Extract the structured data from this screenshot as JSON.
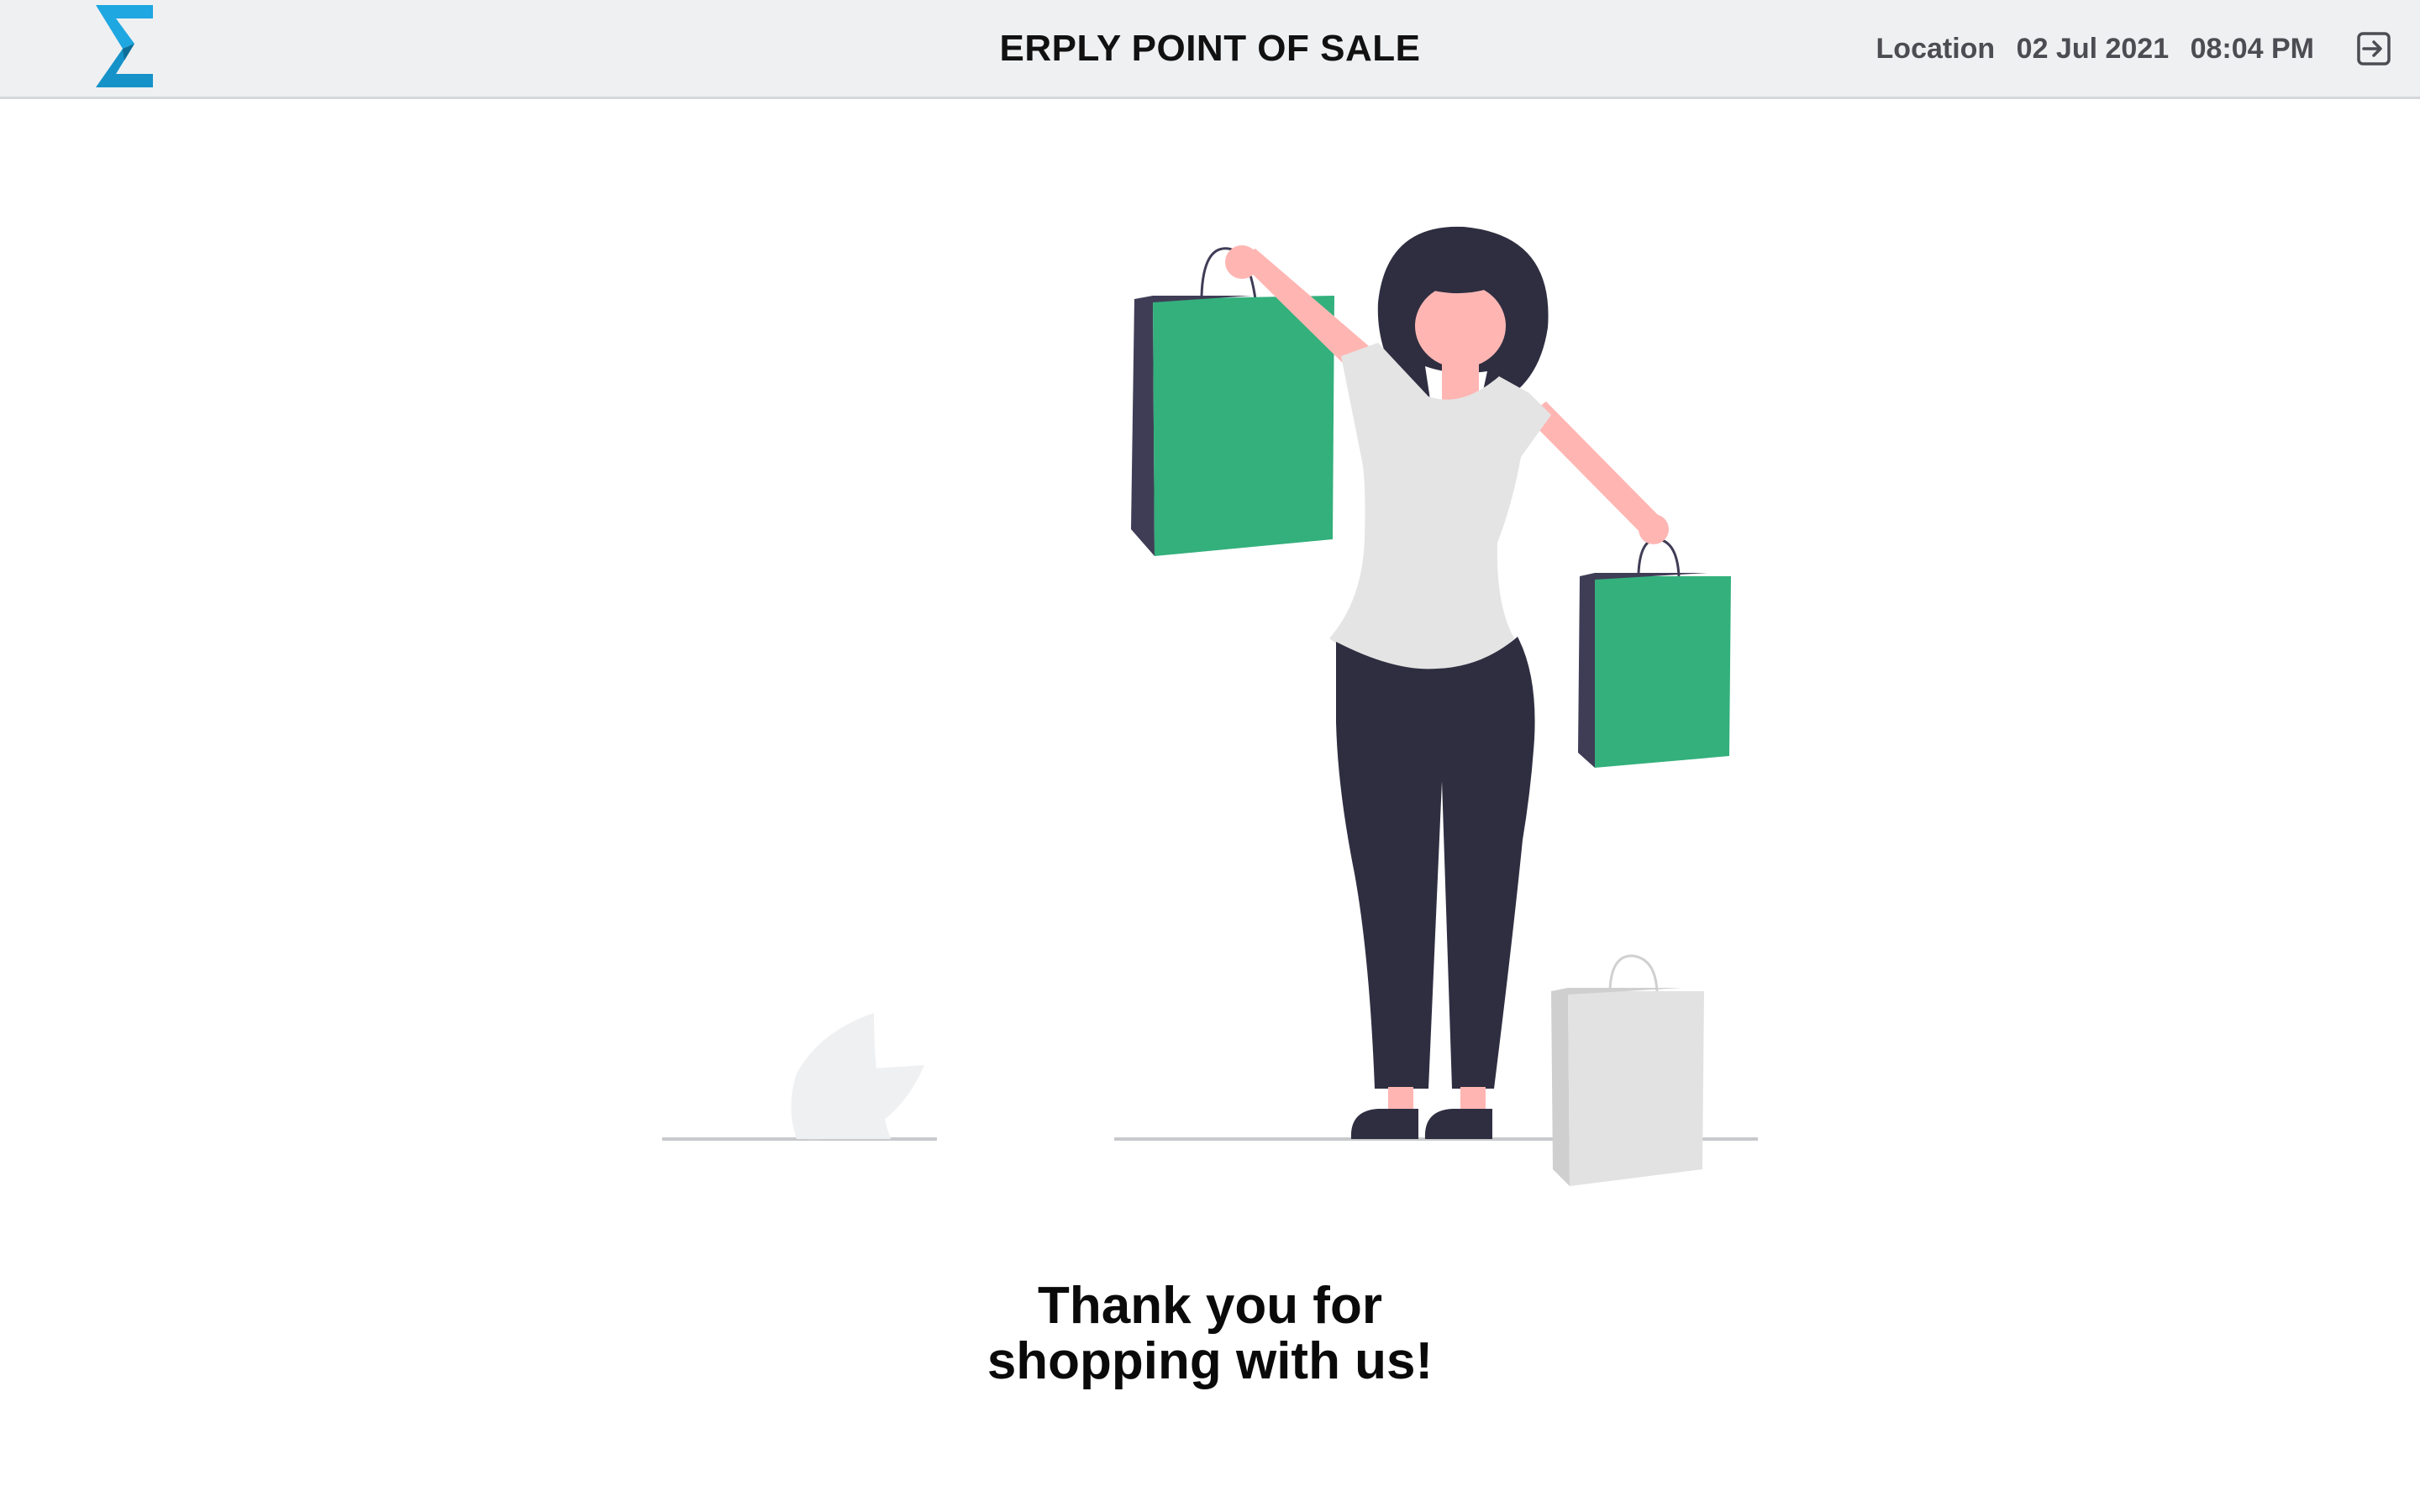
{
  "header": {
    "title": "ERPLY POINT OF SALE",
    "location": "Location",
    "date": "02 Jul 2021",
    "time": "08:04 PM",
    "logo_icon": "erply-sigma-logo",
    "logout_icon": "logout-icon"
  },
  "message": {
    "line1": "Thank you for",
    "line2": "shopping with us!"
  },
  "colors": {
    "header_bg": "#eff0f2",
    "logo": "#1ea7e1",
    "bag_green": "#33b07c",
    "bag_dark": "#3f3d56",
    "pants": "#2f2e41",
    "skin": "#ffb6b3",
    "shirt": "#e4e4e4"
  }
}
